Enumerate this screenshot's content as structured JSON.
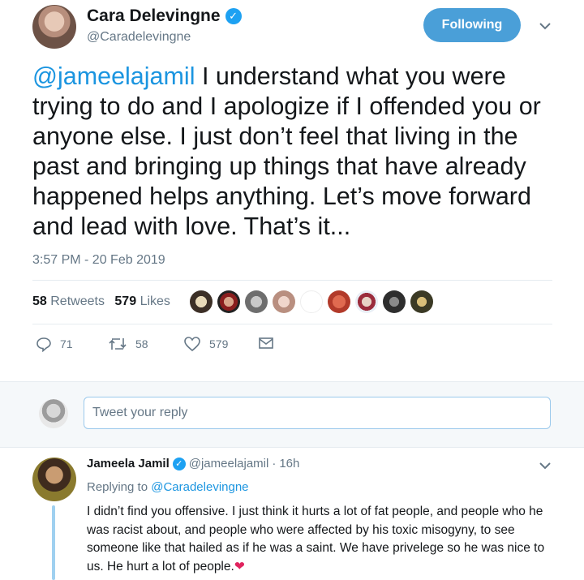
{
  "tweet": {
    "author_name": "Cara Delevingne",
    "author_handle": "@Caradelevingne",
    "follow_label": "Following",
    "mention": "@jameelajamil",
    "text": " I understand what you were trying to do and I apologize if I offended you or anyone else. I just don’t feel that living in the past and bringing up things that have already happened helps anything. Let’s move forward and lead with love. That’s it...",
    "timestamp": "3:57 PM - 20 Feb 2019"
  },
  "stats": {
    "retweets_count": "58",
    "retweets_label": "Retweets",
    "likes_count": "579",
    "likes_label": "Likes"
  },
  "actions": {
    "reply_count": "71",
    "retweet_count": "58",
    "like_count": "579"
  },
  "reply_box": {
    "placeholder": "Tweet your reply"
  },
  "reply": {
    "author_name": "Jameela Jamil",
    "author_handle": "@jameelajamil",
    "separator": "·",
    "time": "16h",
    "replying_prefix": "Replying to",
    "replying_to": "@Caradelevingne",
    "text": "I didn’t find you offensive. I just think it hurts a lot of fat people, and people who he was racist about, and people who were affected by his toxic misogyny, to see someone like that hailed as if he was a saint. We have privelege so he was nice to us. He hurt a lot of people.",
    "heart": "❤"
  },
  "icons": {
    "verified": "✓",
    "chevron": "chevron-down-icon",
    "reply": "reply-icon",
    "retweet": "retweet-icon",
    "like": "heart-icon",
    "dm": "envelope-icon"
  },
  "colors": {
    "accent": "#1da1f2",
    "follow_button": "#4a9fd8",
    "text": "#14171a",
    "muted": "#657786",
    "heart": "#e0245e",
    "thread_line": "#9fd0f0"
  }
}
